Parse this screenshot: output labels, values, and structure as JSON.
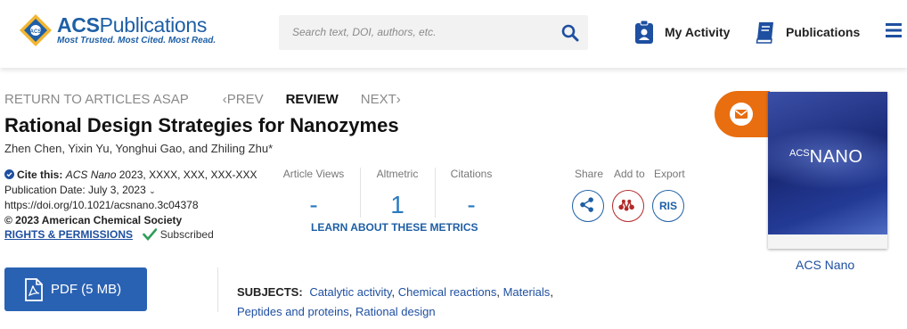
{
  "header": {
    "logo_title_bold": "ACS",
    "logo_title_rest": "Publications",
    "logo_tagline": "Most Trusted. Most Cited. Most Read.",
    "search_placeholder": "Search text, DOI, authors, etc.",
    "my_activity": "My Activity",
    "publications": "Publications"
  },
  "nav": {
    "return": "RETURN TO ARTICLES ASAP",
    "prev": "PREV",
    "current": "REVIEW",
    "next": "NEXT"
  },
  "article": {
    "title": "Rational Design Strategies for Nanozymes",
    "authors": "Zhen Chen, Yixin Yu, Yonghui Gao, and Zhiling Zhu*",
    "cite_label": "Cite this:",
    "cite_journal": "ACS Nano",
    "cite_rest": "2023, XXXX, XXX, XXX-XXX",
    "pub_date": "Publication Date: July 3, 2023",
    "doi": "https://doi.org/10.1021/acsnano.3c04378",
    "copyright": "© 2023 American Chemical Society",
    "rights": "RIGHTS & PERMISSIONS",
    "subscribed": "Subscribed"
  },
  "metrics": {
    "views_label": "Article Views",
    "views_value": "-",
    "altmetric_label": "Altmetric",
    "altmetric_value": "1",
    "citations_label": "Citations",
    "citations_value": "-",
    "learn": "LEARN ABOUT THESE METRICS"
  },
  "actions": {
    "share": "Share",
    "add_to": "Add to",
    "export": "Export",
    "ris": "RIS"
  },
  "journal": {
    "cover_prefix": "ACS",
    "cover_name": "NANO",
    "name": "ACS Nano"
  },
  "pdf": {
    "label": "PDF (5 MB)"
  },
  "subjects": {
    "label": "SUBJECTS:",
    "items": [
      "Catalytic activity",
      "Chemical reactions",
      "Materials",
      "Peptides and proteins",
      "Rational design"
    ]
  },
  "colors": {
    "brand_blue": "#1e5fa6",
    "pdf_blue": "#2a62b3",
    "email_orange": "#e86e10",
    "metric_blue": "#2a7ac0"
  }
}
